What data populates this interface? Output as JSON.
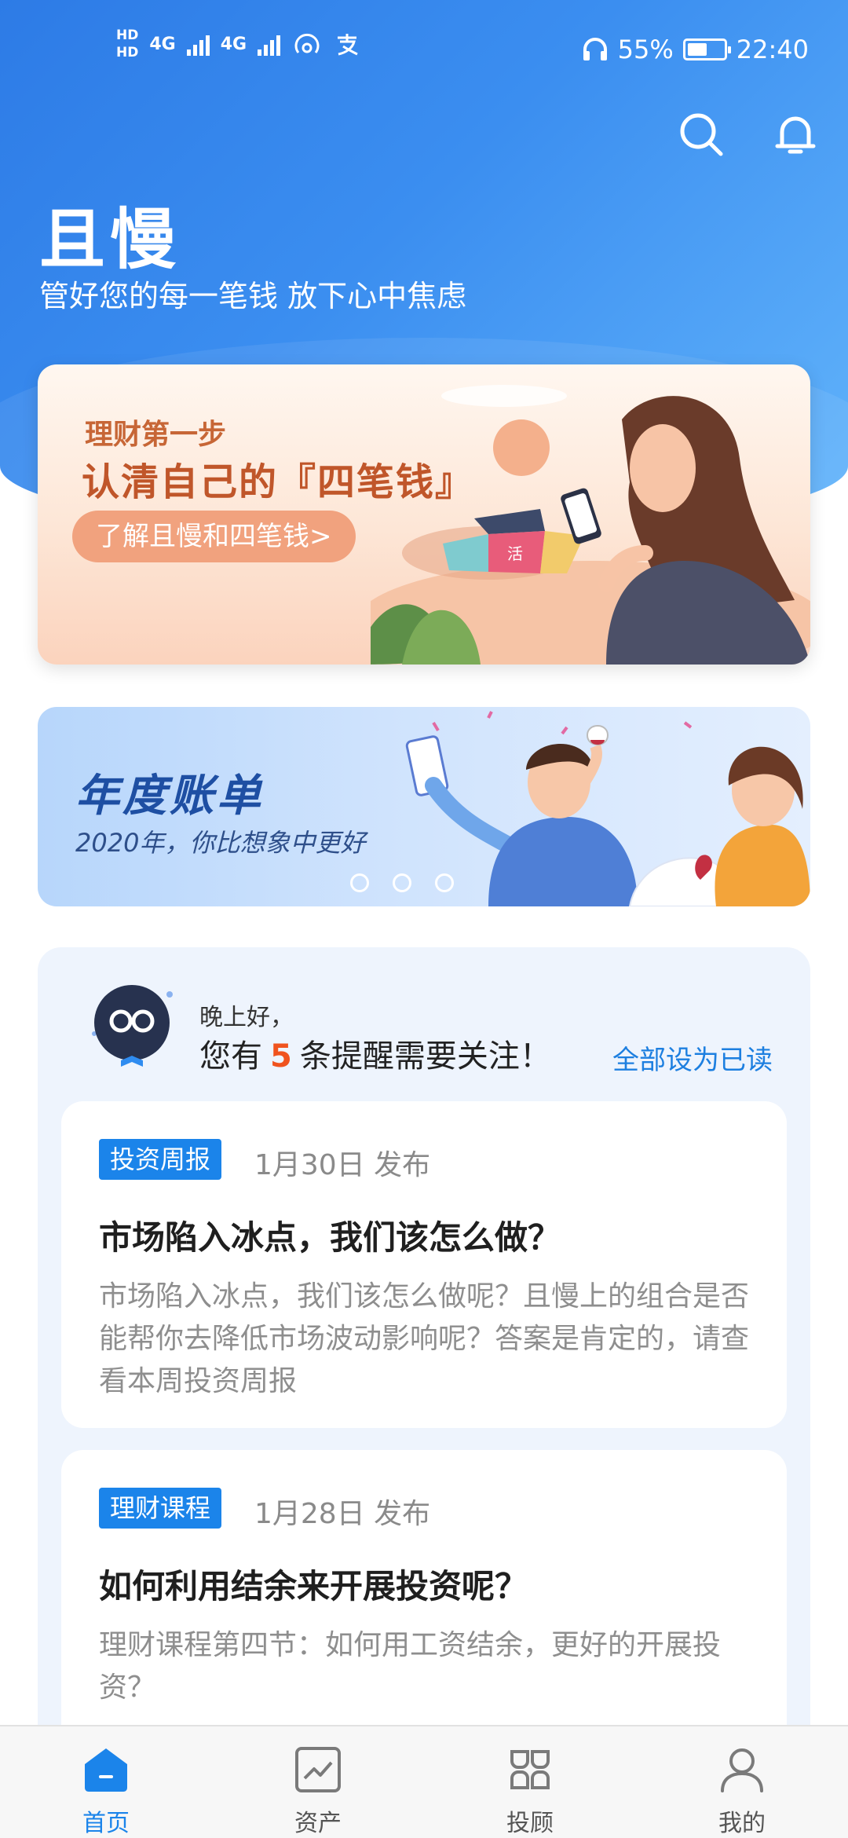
{
  "status_bar": {
    "hd1": "HD",
    "hd2": "HD",
    "net1": "4G",
    "net2": "4G",
    "battery_text": "55%",
    "battery_level": 0.55,
    "time": "22:40"
  },
  "header": {
    "title": "且慢",
    "subtitle": "管好您的每一笔钱 放下心中焦虑"
  },
  "banner1": {
    "kicker": "理财第一步",
    "title": "认清自己的『四笔钱』",
    "button_label": "了解且慢和四笔钱>",
    "chart_label": "活"
  },
  "banner2": {
    "title": "年度账单",
    "subtitle": "2020年，你比想象中更好",
    "dot_count": 3
  },
  "reminders": {
    "greeting": "晚上好，",
    "prefix": "您有",
    "count": "5",
    "suffix": "条提醒需要关注！",
    "mark_all_read": "全部设为已读",
    "cards": [
      {
        "tag": "投资周报",
        "date": "1月30日 发布",
        "title": "市场陷入冰点，我们该怎么做？",
        "body": "市场陷入冰点，我们该怎么做呢？且慢上的组合是否能帮你去降低市场波动影响呢？答案是肯定的，请查看本周投资周报"
      },
      {
        "tag": "理财课程",
        "date": "1月28日 发布",
        "title": "如何利用结余来开展投资呢？",
        "body": "理财课程第四节：如何用工资结余，更好的开展投资？"
      }
    ]
  },
  "tabbar": {
    "items": [
      {
        "label": "首页",
        "icon": "home-icon",
        "active": true
      },
      {
        "label": "资产",
        "icon": "assets-chart-icon",
        "active": false
      },
      {
        "label": "投顾",
        "icon": "advisor-grid-icon",
        "active": false
      },
      {
        "label": "我的",
        "icon": "profile-icon",
        "active": false
      }
    ]
  },
  "colors": {
    "brand_blue": "#1b84ea",
    "header_gradient_start": "#2d7be6",
    "header_gradient_end": "#62b4fb",
    "highlight_orange": "#f0531e"
  }
}
